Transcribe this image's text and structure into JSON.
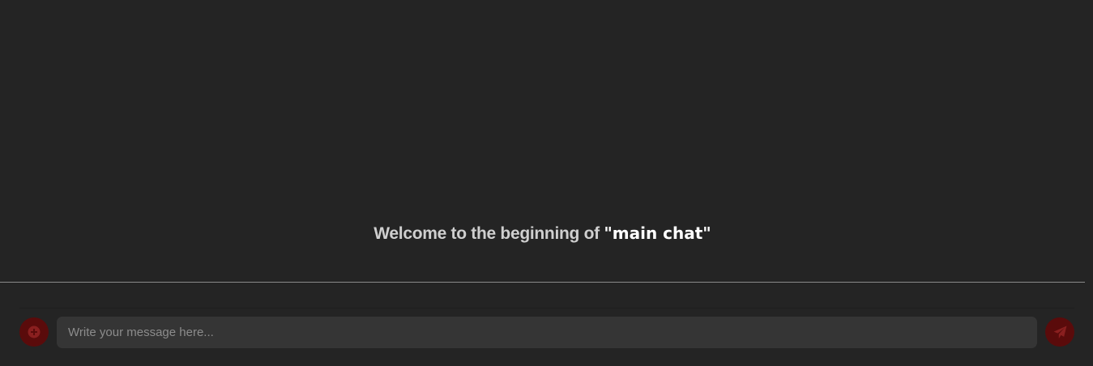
{
  "chat": {
    "welcome_prefix": "Welcome to the beginning of ",
    "channel_name": "\"main chat\""
  },
  "composer": {
    "placeholder": "Write your message here...",
    "value": "",
    "add_icon": "plus-circle-icon",
    "send_icon": "paper-plane-icon"
  },
  "colors": {
    "background": "#242424",
    "input_background": "#353535",
    "button_background": "#5a0b0b",
    "icon_color": "#8a1f1f",
    "divider": "#8a8a8a"
  }
}
